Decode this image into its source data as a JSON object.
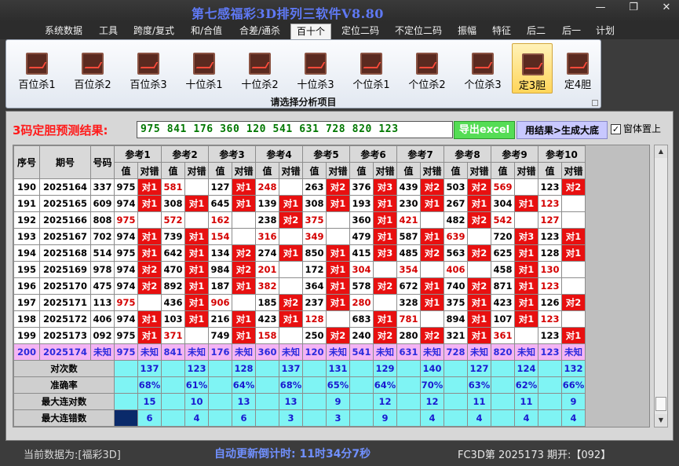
{
  "window": {
    "title": "第七感福彩3D排列三软件V8.80",
    "controls": [
      "—",
      "❐",
      "✕"
    ]
  },
  "menu": [
    "系统数据",
    "工具",
    "跨度/复式",
    "和/合值",
    "合差/通杀",
    "百十个",
    "定位二码",
    "不定位二码",
    "振幅",
    "特征",
    "后二",
    "后一",
    "计划"
  ],
  "active_menu": "百十个",
  "ribbon": {
    "buttons": [
      "百位杀1",
      "百位杀2",
      "百位杀3",
      "十位杀1",
      "十位杀2",
      "十位杀3",
      "个位杀1",
      "个位杀2",
      "个位杀3",
      "定3胆",
      "定4胆"
    ],
    "active": "定3胆",
    "caption": "请选择分析项目"
  },
  "prediction": {
    "label": "3码定胆预测结果:",
    "value": "975 841 176 360 120 541 631 728 820 123",
    "export_button": "导出excel",
    "generate_button": "用结果>生成大底",
    "on_top_label": "窗体置上",
    "on_top_checked": true
  },
  "table": {
    "headers": {
      "seq": "序号",
      "issue": "期号",
      "number": "号码",
      "refs": [
        "参考1",
        "参考2",
        "参考3",
        "参考4",
        "参考5",
        "参考6",
        "参考7",
        "参考8",
        "参考9",
        "参考10"
      ],
      "sub_value": "值",
      "sub_result": "对错"
    },
    "rows": [
      {
        "seq": "190",
        "issue": "2025164",
        "num": "337",
        "cells": [
          [
            "975",
            ""
          ],
          [
            "581",
            "对1"
          ],
          [
            "",
            ""
          ],
          [
            "127",
            "对1"
          ],
          [
            "248",
            ""
          ],
          [
            "263",
            "对2"
          ],
          [
            "376",
            "对3"
          ],
          [
            "439",
            "对2"
          ],
          [
            "503",
            "对2"
          ],
          [
            "569",
            ""
          ],
          [
            "123",
            "对2"
          ]
        ]
      },
      {
        "seq": "191",
        "issue": "2025165",
        "num": "609",
        "cells": [
          [
            "974",
            "对1"
          ],
          [
            "308",
            "对1"
          ],
          [
            "645",
            "对1"
          ],
          [
            "139",
            "对1"
          ],
          [
            "308",
            "对1"
          ],
          [
            "193",
            "对1"
          ],
          [
            "230",
            "对1"
          ],
          [
            "267",
            "对1"
          ],
          [
            "304",
            "对1"
          ],
          [
            "123",
            ""
          ]
        ]
      },
      {
        "seq": "192",
        "issue": "2025166",
        "num": "808",
        "cells": [
          [
            "975",
            ""
          ],
          [
            "572",
            ""
          ],
          [
            "162",
            ""
          ],
          [
            "238",
            "对2"
          ],
          [
            "375",
            ""
          ],
          [
            "360",
            "对1"
          ],
          [
            "421",
            ""
          ],
          [
            "482",
            "对2"
          ],
          [
            "542",
            ""
          ],
          [
            "127",
            ""
          ]
        ]
      },
      {
        "seq": "193",
        "issue": "2025167",
        "num": "702",
        "cells": [
          [
            "974",
            "对1"
          ],
          [
            "739",
            "对1"
          ],
          [
            "154",
            ""
          ],
          [
            "316",
            ""
          ],
          [
            "349",
            ""
          ],
          [
            "479",
            "对1"
          ],
          [
            "587",
            "对1"
          ],
          [
            "639",
            ""
          ],
          [
            "720",
            "对3"
          ],
          [
            "123",
            "对1"
          ]
        ]
      },
      {
        "seq": "194",
        "issue": "2025168",
        "num": "514",
        "cells": [
          [
            "975",
            "对1"
          ],
          [
            "642",
            "对1"
          ],
          [
            "134",
            "对2"
          ],
          [
            "274",
            "对1"
          ],
          [
            "850",
            "对1"
          ],
          [
            "415",
            "对3"
          ],
          [
            "485",
            "对2"
          ],
          [
            "563",
            "对2"
          ],
          [
            "625",
            "对1"
          ],
          [
            "128",
            "对1"
          ]
        ]
      },
      {
        "seq": "195",
        "issue": "2025169",
        "num": "978",
        "cells": [
          [
            "974",
            "对2"
          ],
          [
            "470",
            "对1"
          ],
          [
            "984",
            "对2"
          ],
          [
            "201",
            ""
          ],
          [
            "172",
            "对1"
          ],
          [
            "304",
            ""
          ],
          [
            "354",
            ""
          ],
          [
            "406",
            ""
          ],
          [
            "458",
            "对1"
          ],
          [
            "130",
            ""
          ]
        ]
      },
      {
        "seq": "196",
        "issue": "2025170",
        "num": "475",
        "cells": [
          [
            "974",
            "对2"
          ],
          [
            "892",
            "对1"
          ],
          [
            "187",
            "对1"
          ],
          [
            "382",
            ""
          ],
          [
            "364",
            "对1"
          ],
          [
            "578",
            "对2"
          ],
          [
            "672",
            "对1"
          ],
          [
            "740",
            "对2"
          ],
          [
            "871",
            "对1"
          ],
          [
            "123",
            ""
          ]
        ]
      },
      {
        "seq": "197",
        "issue": "2025171",
        "num": "113",
        "cells": [
          [
            "975",
            ""
          ],
          [
            "436",
            "对1"
          ],
          [
            "906",
            ""
          ],
          [
            "185",
            "对2"
          ],
          [
            "237",
            "对1"
          ],
          [
            "280",
            ""
          ],
          [
            "328",
            "对1"
          ],
          [
            "375",
            "对1"
          ],
          [
            "423",
            "对1"
          ],
          [
            "126",
            "对2"
          ]
        ]
      },
      {
        "seq": "198",
        "issue": "2025172",
        "num": "406",
        "cells": [
          [
            "974",
            "对1"
          ],
          [
            "103",
            "对1"
          ],
          [
            "216",
            "对1"
          ],
          [
            "423",
            "对1"
          ],
          [
            "128",
            ""
          ],
          [
            "683",
            "对1"
          ],
          [
            "781",
            ""
          ],
          [
            "894",
            "对1"
          ],
          [
            "107",
            "对1"
          ],
          [
            "123",
            ""
          ]
        ]
      },
      {
        "seq": "199",
        "issue": "2025173",
        "num": "092",
        "cells": [
          [
            "975",
            "对1"
          ],
          [
            "371",
            ""
          ],
          [
            "749",
            "对1"
          ],
          [
            "158",
            ""
          ],
          [
            "250",
            "对2"
          ],
          [
            "240",
            "对2"
          ],
          [
            "280",
            "对2"
          ],
          [
            "321",
            "对1"
          ],
          [
            "361",
            ""
          ],
          [
            "123",
            "对1"
          ]
        ]
      }
    ],
    "pred_row": {
      "seq": "200",
      "issue": "2025174",
      "num": "未知",
      "values": [
        "975",
        "841",
        "176",
        "360",
        "120",
        "541",
        "631",
        "728",
        "820",
        "123"
      ],
      "result": "未知"
    },
    "stats": [
      {
        "label": "对次数",
        "values": [
          "137",
          "123",
          "128",
          "137",
          "131",
          "129",
          "140",
          "127",
          "124",
          "132"
        ]
      },
      {
        "label": "准确率",
        "values": [
          "68%",
          "61%",
          "64%",
          "68%",
          "65%",
          "64%",
          "70%",
          "63%",
          "62%",
          "66%"
        ]
      },
      {
        "label": "最大连对数",
        "values": [
          "15",
          "10",
          "13",
          "13",
          "9",
          "12",
          "12",
          "11",
          "11",
          "9"
        ]
      },
      {
        "label": "最大连错数",
        "values": [
          "6",
          "4",
          "6",
          "3",
          "3",
          "9",
          "4",
          "4",
          "4",
          "4"
        ]
      }
    ]
  },
  "status": {
    "left": "当前数据为:[福彩3D]",
    "countdown": "自动更新倒计时:  11时34分7秒",
    "right": "FC3D第 2025173 期开:【092】"
  },
  "colors": {
    "hit": "#e81010",
    "pred_row": "#f4b4f4",
    "stat_row": "#7ff4f4",
    "title": "#5f79f5"
  }
}
